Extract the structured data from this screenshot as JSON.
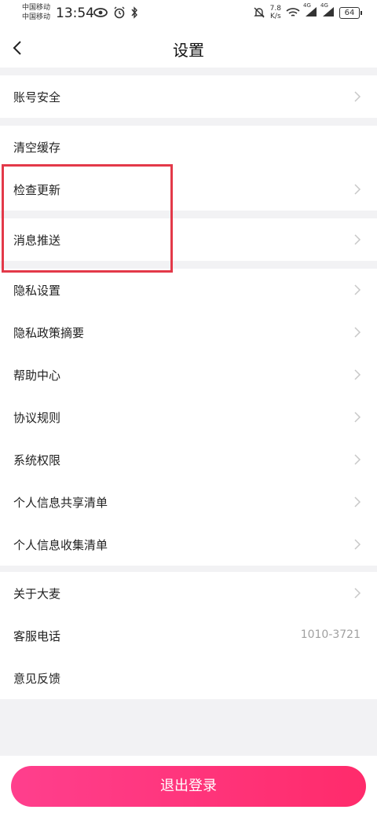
{
  "status_bar": {
    "carrier_1": "中国移动",
    "carrier_2": "中国移动",
    "time": "13:54",
    "net_speed_value": "7.8",
    "net_speed_unit": "K/s",
    "signal_1_label": "4G",
    "signal_2_label": "4G",
    "battery": "64"
  },
  "header": {
    "title": "设置"
  },
  "sections": [
    {
      "items": [
        {
          "label": "账号安全",
          "chevron": true
        }
      ]
    },
    {
      "items": [
        {
          "label": "清空缓存",
          "chevron": false
        },
        {
          "label": "检查更新",
          "chevron": true
        }
      ]
    },
    {
      "items": [
        {
          "label": "消息推送",
          "chevron": true
        }
      ]
    },
    {
      "items": [
        {
          "label": "隐私设置",
          "chevron": true
        },
        {
          "label": "隐私政策摘要",
          "chevron": true
        },
        {
          "label": "帮助中心",
          "chevron": true
        },
        {
          "label": "协议规则",
          "chevron": true
        },
        {
          "label": "系统权限",
          "chevron": true
        },
        {
          "label": "个人信息共享清单",
          "chevron": true
        },
        {
          "label": "个人信息收集清单",
          "chevron": true
        }
      ]
    },
    {
      "items": [
        {
          "label": "关于大麦",
          "chevron": true
        },
        {
          "label": "客服电话",
          "value": "1010-3721"
        },
        {
          "label": "意见反馈",
          "chevron": false
        }
      ]
    }
  ],
  "logout_button": {
    "label": "退出登录"
  },
  "colors": {
    "accent_gradient_start": "#ff3f8d",
    "accent_gradient_end": "#ff2b6b",
    "highlight_border": "#e33949"
  }
}
